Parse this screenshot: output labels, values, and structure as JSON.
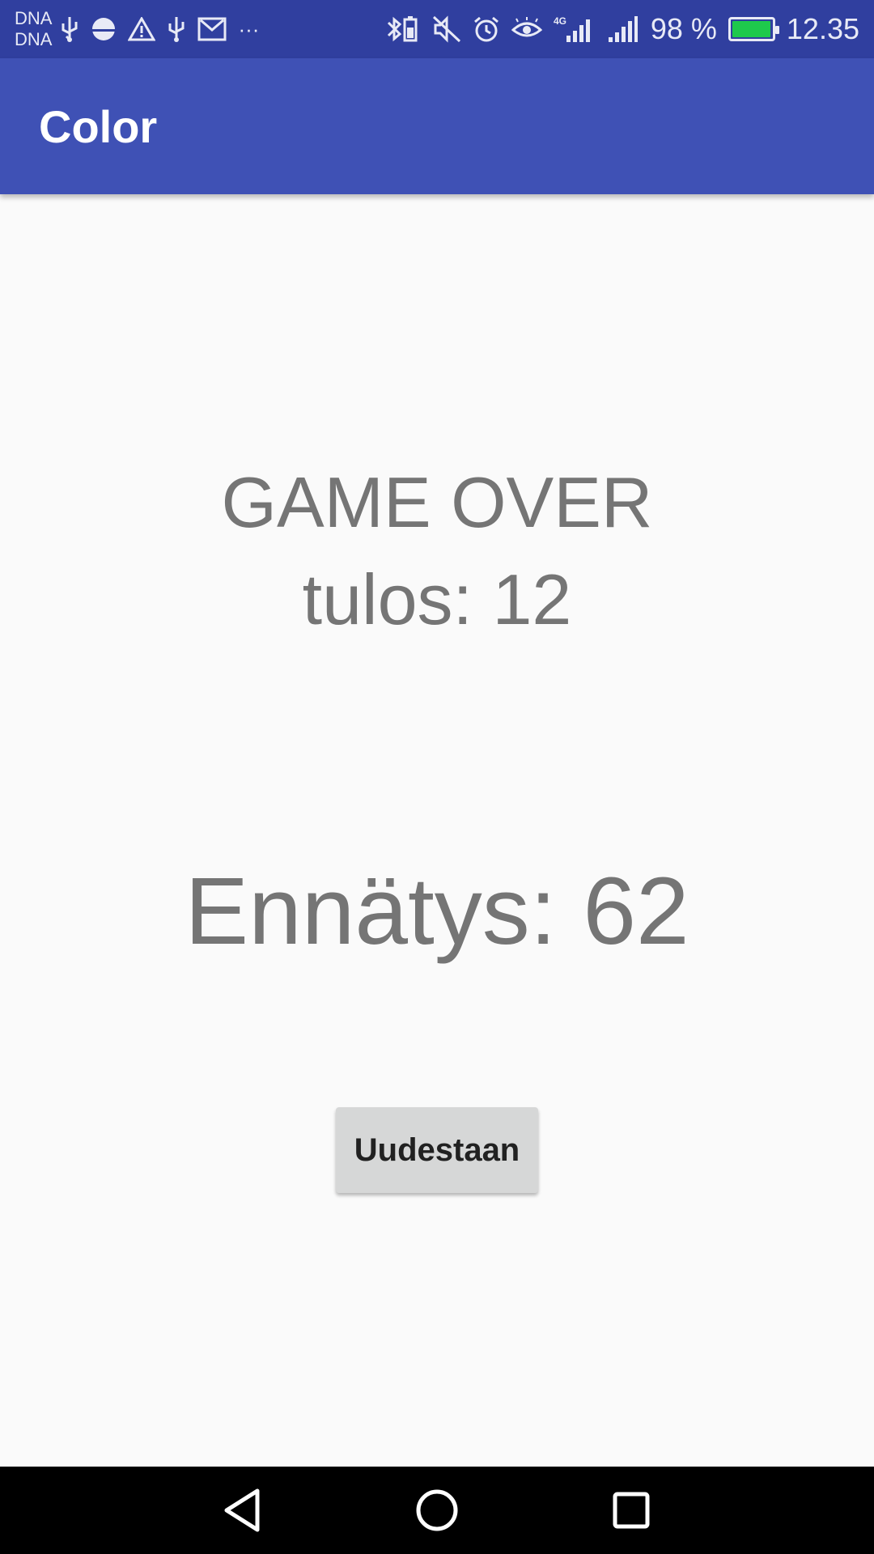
{
  "status_bar": {
    "carrier_1": "DNA",
    "carrier_2": "DNA",
    "more_indicator": "···",
    "battery_percent": "98 %",
    "battery_level": 0.98,
    "clock": "12.35",
    "icons_left": [
      "usb-icon",
      "data-saver-icon",
      "warning-icon",
      "usb-icon",
      "gmail-icon"
    ],
    "icons_right": [
      "bluetooth-battery-icon",
      "mute-icon",
      "alarm-icon",
      "eye-comfort-icon",
      "signal-4g-icon",
      "signal-icon",
      "battery-icon"
    ]
  },
  "app_bar": {
    "title": "Color",
    "color": "#3f51b5"
  },
  "main": {
    "game_over": "GAME OVER",
    "score": "tulos: 12",
    "record": "Ennätys: 62",
    "retry_button": "Uudestaan"
  },
  "nav_bar": {
    "icons": [
      "back-icon",
      "home-icon",
      "recents-icon"
    ]
  }
}
